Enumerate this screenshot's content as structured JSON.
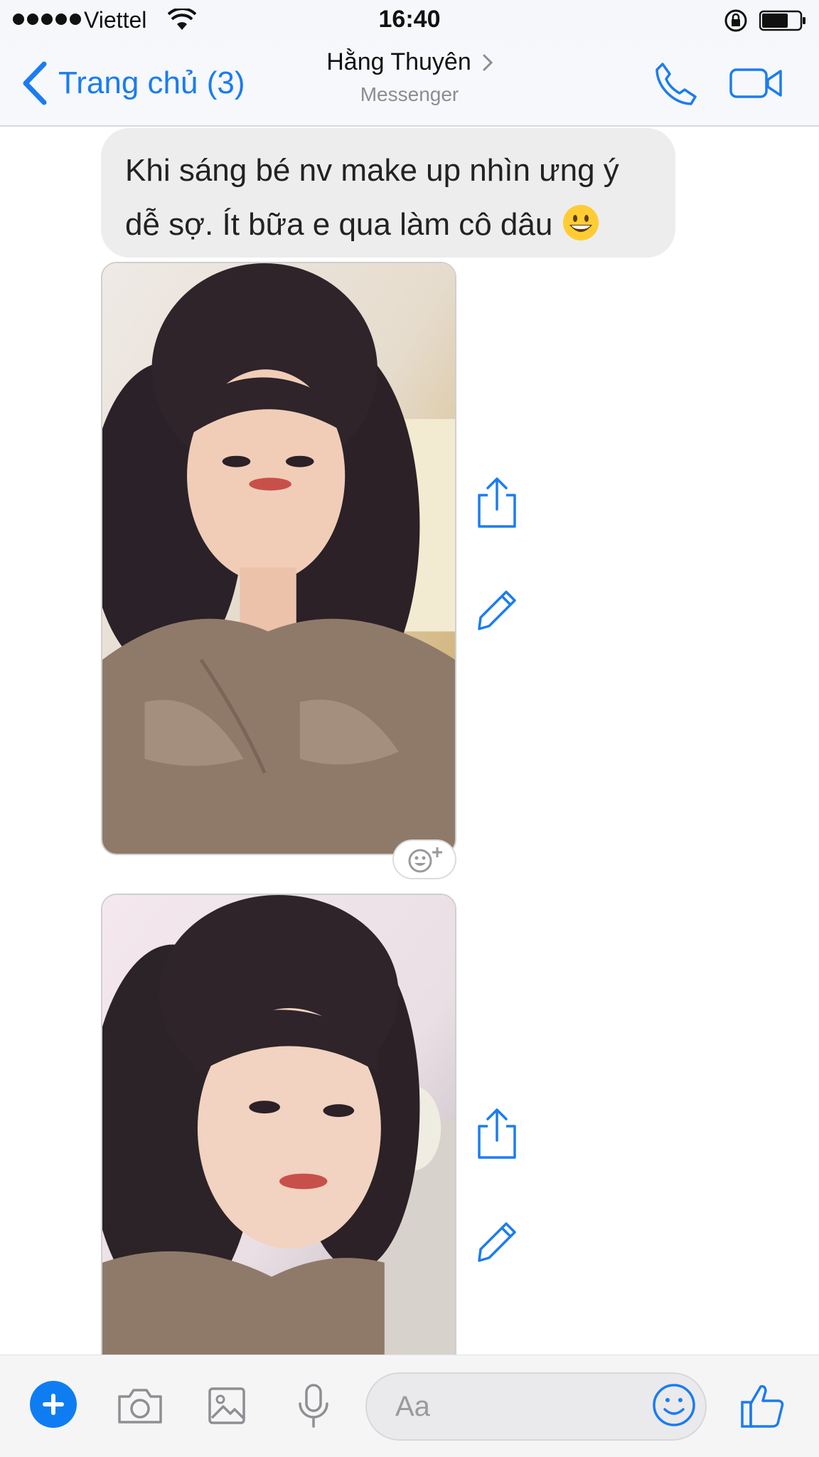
{
  "status_bar": {
    "carrier": "Viettel",
    "time": "16:40"
  },
  "nav": {
    "back_label": "Trang chủ (3)",
    "contact_name": "Hằng Thuyên",
    "subtitle": "Messenger"
  },
  "messages": [
    {
      "type": "text",
      "sender": "contact",
      "text": "Khi sáng bé nv make up nhìn ưng ý dễ sợ. Ít bữa e qua làm cô dâu",
      "emoji": "grinning-face"
    },
    {
      "type": "photo",
      "sender": "contact",
      "description_icon": "selfie-photo"
    },
    {
      "type": "photo",
      "sender": "contact",
      "description_icon": "selfie-photo"
    }
  ],
  "composer": {
    "placeholder": "Aa"
  },
  "colors": {
    "accent": "#1b7cf2",
    "bubble": "#ededed",
    "header_bg": "#f5f7fb"
  }
}
